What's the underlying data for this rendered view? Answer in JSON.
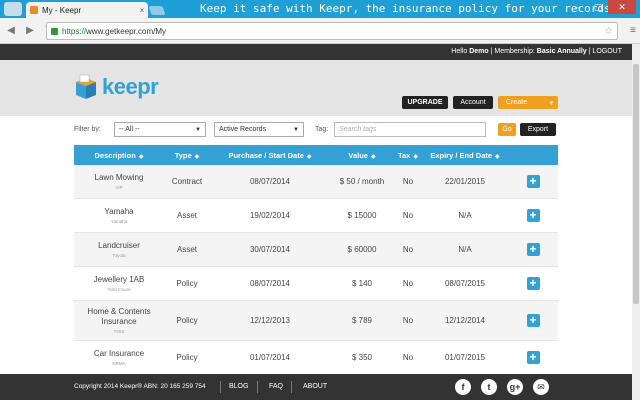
{
  "browser": {
    "tab_title": "My - Keepr",
    "tab_close": "×",
    "banner": "Keep it safe with Keepr, the insurance policy for your records",
    "url_secure": "https://",
    "url_rest": "www.getkeepr.com/My",
    "window_controls": [
      "–",
      "▢",
      "✕"
    ]
  },
  "topbar": {
    "greeting": "Hello ",
    "user": "Demo",
    "membership_label": " | Membership: ",
    "membership": "Basic Annually",
    "logout": " | LOGOUT"
  },
  "header": {
    "brand": "keepr",
    "upgrade": "UPGRADE",
    "account": "Account",
    "create": "Create",
    "create_arrow": "▾"
  },
  "filters": {
    "filter_label": "Filter by:",
    "filter_value": "-- All --",
    "status_value": "Active Records",
    "tag_label": "Tag:",
    "tag_placeholder": "Search tags",
    "go": "Go",
    "export": "Export"
  },
  "table": {
    "columns": [
      "Description",
      "Type",
      "Purchase / Start Date",
      "Value",
      "Tax",
      "Expiry / End Date",
      ""
    ],
    "sort_icon": "◆",
    "rows": [
      {
        "name": "Lawn Mowing",
        "sub": "VIP",
        "type": "Contract",
        "start": "08/07/2014",
        "value": "$ 50 / month",
        "tax": "No",
        "expiry": "22/01/2015"
      },
      {
        "name": "Yamaha",
        "sub": "Yamaha",
        "type": "Asset",
        "start": "19/02/2014",
        "value": "$ 15000",
        "tax": "No",
        "expiry": "N/A"
      },
      {
        "name": "Landcruiser",
        "sub": "Toyota",
        "type": "Asset",
        "start": "30/07/2014",
        "value": "$ 60000",
        "tax": "No",
        "expiry": "N/A"
      },
      {
        "name": "Jewellery 1AB",
        "sub": "Gold Insure",
        "type": "Policy",
        "start": "08/07/2014",
        "value": "$ 140",
        "tax": "No",
        "expiry": "08/07/2015"
      },
      {
        "name": "Home & Contents Insurance",
        "sub": "YOUI",
        "type": "Policy",
        "start": "12/12/2013",
        "value": "$ 789",
        "tax": "No",
        "expiry": "12/12/2014"
      },
      {
        "name": "Car Insurance",
        "sub": "NRMA",
        "type": "Policy",
        "start": "01/07/2014",
        "value": "$ 350",
        "tax": "No",
        "expiry": "01/07/2015"
      }
    ]
  },
  "footer": {
    "copyright": "Copyright 2014 Keepr® ABN: 20 165 259 754",
    "blog": "BLOG",
    "faq": "FAQ",
    "about": "ABOUT",
    "social": [
      "f",
      "t",
      "g+",
      "✉"
    ]
  },
  "colors": {
    "accent": "#35a0d3",
    "orange": "#f0a020",
    "dark": "#333333"
  }
}
